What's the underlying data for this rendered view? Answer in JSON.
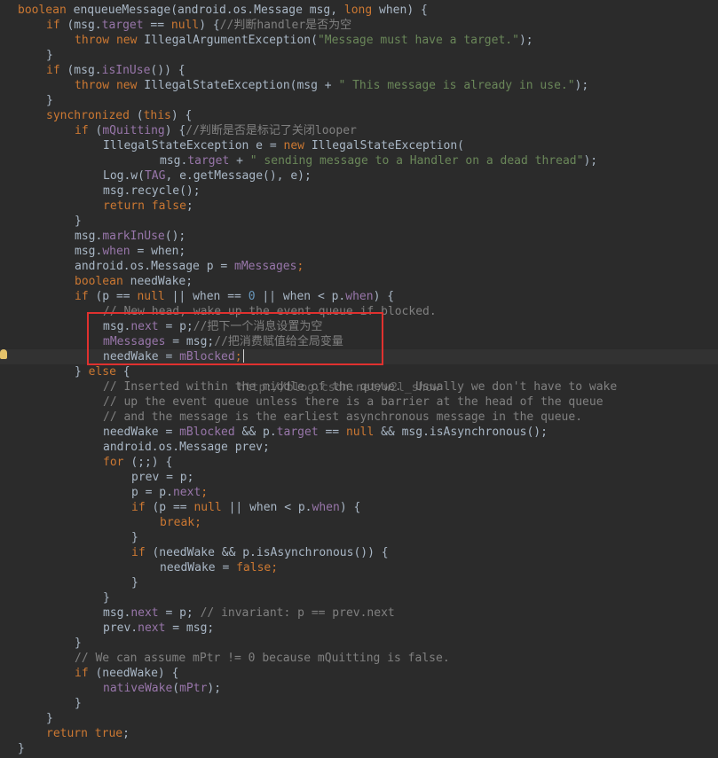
{
  "watermark": "http://blog.csdn.net/w2l_show",
  "lines": [
    {
      "indent": 0,
      "tokens": [
        [
          "kw",
          "boolean "
        ],
        [
          "default",
          "enqueueMessage(android.os.Message msg, "
        ],
        [
          "kw",
          "long "
        ],
        [
          "default",
          "when) {"
        ]
      ]
    },
    {
      "indent": 1,
      "tokens": [
        [
          "kw",
          "if "
        ],
        [
          "default",
          "(msg."
        ],
        [
          "fld",
          "target"
        ],
        [
          "default",
          " == "
        ],
        [
          "kw",
          "null"
        ],
        [
          "default",
          ") {"
        ],
        [
          "cmt",
          "//判断handler是否为空"
        ]
      ]
    },
    {
      "indent": 2,
      "tokens": [
        [
          "kw",
          "throw new "
        ],
        [
          "default",
          "IllegalArgumentException("
        ],
        [
          "str",
          "\"Message must have a target.\""
        ],
        [
          "default",
          ");"
        ]
      ]
    },
    {
      "indent": 1,
      "tokens": [
        [
          "default",
          "}"
        ]
      ]
    },
    {
      "indent": 1,
      "tokens": [
        [
          "kw",
          "if "
        ],
        [
          "default",
          "(msg."
        ],
        [
          "fld",
          "isInUse"
        ],
        [
          "default",
          "()) {"
        ]
      ]
    },
    {
      "indent": 2,
      "tokens": [
        [
          "kw",
          "throw new "
        ],
        [
          "default",
          "IllegalStateException(msg + "
        ],
        [
          "str",
          "\" This message is already in use.\""
        ],
        [
          "default",
          ");"
        ]
      ]
    },
    {
      "indent": 1,
      "tokens": [
        [
          "default",
          "}"
        ]
      ]
    },
    {
      "indent": 1,
      "tokens": [
        [
          "kw",
          "synchronized "
        ],
        [
          "default",
          "("
        ],
        [
          "kw",
          "this"
        ],
        [
          "default",
          ") {"
        ]
      ]
    },
    {
      "indent": 2,
      "tokens": [
        [
          "kw",
          "if "
        ],
        [
          "default",
          "("
        ],
        [
          "fld",
          "mQuitting"
        ],
        [
          "default",
          ") {"
        ],
        [
          "cmt",
          "//判断是否是标记了关闭looper"
        ]
      ]
    },
    {
      "indent": 3,
      "tokens": [
        [
          "default",
          "IllegalStateException e = "
        ],
        [
          "kw",
          "new "
        ],
        [
          "default",
          "IllegalStateException("
        ]
      ]
    },
    {
      "indent": 5,
      "tokens": [
        [
          "default",
          "msg."
        ],
        [
          "fld",
          "target"
        ],
        [
          "default",
          " + "
        ],
        [
          "str",
          "\" sending message to a Handler on a dead thread\""
        ],
        [
          "default",
          ");"
        ]
      ]
    },
    {
      "indent": 3,
      "tokens": [
        [
          "default",
          "Log.w("
        ],
        [
          "fld",
          "TAG"
        ],
        [
          "default",
          ", e.getMessage(), e);"
        ]
      ]
    },
    {
      "indent": 3,
      "tokens": [
        [
          "default",
          "msg.recycle();"
        ]
      ]
    },
    {
      "indent": 3,
      "tokens": [
        [
          "kw",
          "return false"
        ],
        [
          "default",
          ";"
        ]
      ]
    },
    {
      "indent": 2,
      "tokens": [
        [
          "default",
          "}"
        ]
      ]
    },
    {
      "indent": 2,
      "tokens": [
        [
          "default",
          "msg."
        ],
        [
          "fld",
          "markInUse"
        ],
        [
          "default",
          "();"
        ]
      ]
    },
    {
      "indent": 2,
      "tokens": [
        [
          "default",
          "msg."
        ],
        [
          "fld",
          "when"
        ],
        [
          "default",
          " = when;"
        ]
      ]
    },
    {
      "indent": 2,
      "tokens": [
        [
          "default",
          "android.os.Message p = "
        ],
        [
          "fld",
          "mMessages"
        ],
        [
          "kw",
          ";"
        ]
      ]
    },
    {
      "indent": 2,
      "tokens": [
        [
          "kw",
          "boolean "
        ],
        [
          "default",
          "needWake;"
        ]
      ]
    },
    {
      "indent": 2,
      "tokens": [
        [
          "kw",
          "if "
        ],
        [
          "default",
          "(p == "
        ],
        [
          "kw",
          "null "
        ],
        [
          "default",
          "|| when == "
        ],
        [
          "num",
          "0 "
        ],
        [
          "default",
          "|| when < p."
        ],
        [
          "fld",
          "when"
        ],
        [
          "default",
          ") {"
        ]
      ]
    },
    {
      "indent": 3,
      "tokens": [
        [
          "cmt",
          "// New head, wake up the event queue if blocked."
        ]
      ]
    },
    {
      "indent": 3,
      "tokens": [
        [
          "default",
          "msg."
        ],
        [
          "fld",
          "next"
        ],
        [
          "default",
          " = p;"
        ],
        [
          "cmt",
          "//把下一个消息设置为空"
        ]
      ]
    },
    {
      "indent": 3,
      "tokens": [
        [
          "fld",
          "mMessages"
        ],
        [
          "default",
          " = msg;"
        ],
        [
          "cmt",
          "//把消费赋值给全局变量"
        ]
      ]
    },
    {
      "indent": 3,
      "tokens": [
        [
          "default",
          "needWake = "
        ],
        [
          "fld",
          "mBlocked"
        ],
        [
          "kw",
          ";"
        ]
      ]
    },
    {
      "indent": 2,
      "tokens": [
        [
          "default",
          "} "
        ],
        [
          "kw",
          "else "
        ],
        [
          "default",
          "{"
        ]
      ]
    },
    {
      "indent": 3,
      "tokens": [
        [
          "cmt",
          "// Inserted within the middle of the queue.  Usually we don't have to wake"
        ]
      ]
    },
    {
      "indent": 3,
      "tokens": [
        [
          "cmt",
          "// up the event queue unless there is a barrier at the head of the queue"
        ]
      ]
    },
    {
      "indent": 3,
      "tokens": [
        [
          "cmt",
          "// and the message is the earliest asynchronous message in the queue."
        ]
      ]
    },
    {
      "indent": 3,
      "tokens": [
        [
          "default",
          "needWake = "
        ],
        [
          "fld",
          "mBlocked "
        ],
        [
          "default",
          "&& p."
        ],
        [
          "fld",
          "target"
        ],
        [
          "default",
          " == "
        ],
        [
          "kw",
          "null "
        ],
        [
          "default",
          "&& msg.isAsynchronous();"
        ]
      ]
    },
    {
      "indent": 3,
      "tokens": [
        [
          "default",
          "android.os.Message prev;"
        ]
      ]
    },
    {
      "indent": 3,
      "tokens": [
        [
          "kw",
          "for "
        ],
        [
          "default",
          "(;;) {"
        ]
      ]
    },
    {
      "indent": 4,
      "tokens": [
        [
          "default",
          "prev = p;"
        ]
      ]
    },
    {
      "indent": 4,
      "tokens": [
        [
          "default",
          "p = p."
        ],
        [
          "fld",
          "next"
        ],
        [
          "kw",
          ";"
        ]
      ]
    },
    {
      "indent": 4,
      "tokens": [
        [
          "kw",
          "if "
        ],
        [
          "default",
          "(p == "
        ],
        [
          "kw",
          "null "
        ],
        [
          "default",
          "|| when < p."
        ],
        [
          "fld",
          "when"
        ],
        [
          "default",
          ") {"
        ]
      ]
    },
    {
      "indent": 5,
      "tokens": [
        [
          "kw",
          "break;"
        ]
      ]
    },
    {
      "indent": 4,
      "tokens": [
        [
          "default",
          "}"
        ]
      ]
    },
    {
      "indent": 4,
      "tokens": [
        [
          "kw",
          "if "
        ],
        [
          "default",
          "(needWake && p.isAsynchronous()) {"
        ]
      ]
    },
    {
      "indent": 5,
      "tokens": [
        [
          "default",
          "needWake = "
        ],
        [
          "kw",
          "false;"
        ]
      ]
    },
    {
      "indent": 4,
      "tokens": [
        [
          "default",
          "}"
        ]
      ]
    },
    {
      "indent": 3,
      "tokens": [
        [
          "default",
          "}"
        ]
      ]
    },
    {
      "indent": 3,
      "tokens": [
        [
          "default",
          "msg."
        ],
        [
          "fld",
          "next"
        ],
        [
          "default",
          " = p; "
        ],
        [
          "cmt",
          "// invariant: p == prev.next"
        ]
      ]
    },
    {
      "indent": 3,
      "tokens": [
        [
          "default",
          "prev."
        ],
        [
          "fld",
          "next"
        ],
        [
          "default",
          " = msg;"
        ]
      ]
    },
    {
      "indent": 2,
      "tokens": [
        [
          "default",
          "}"
        ]
      ]
    },
    {
      "indent": 2,
      "tokens": [
        [
          "cmt",
          "// We can assume mPtr != 0 because mQuitting is false."
        ]
      ]
    },
    {
      "indent": 2,
      "tokens": [
        [
          "kw",
          "if "
        ],
        [
          "default",
          "(needWake) {"
        ]
      ]
    },
    {
      "indent": 3,
      "tokens": [
        [
          "fld",
          "nativeWake"
        ],
        [
          "default",
          "("
        ],
        [
          "fld",
          "mPtr"
        ],
        [
          "default",
          ");"
        ]
      ]
    },
    {
      "indent": 2,
      "tokens": [
        [
          "default",
          "}"
        ]
      ]
    },
    {
      "indent": 1,
      "tokens": [
        [
          "default",
          "}"
        ]
      ]
    },
    {
      "indent": 1,
      "tokens": [
        [
          "kw",
          "return true"
        ],
        [
          "default",
          ";"
        ]
      ]
    },
    {
      "indent": 0,
      "tokens": [
        [
          "default",
          "}"
        ]
      ]
    }
  ]
}
